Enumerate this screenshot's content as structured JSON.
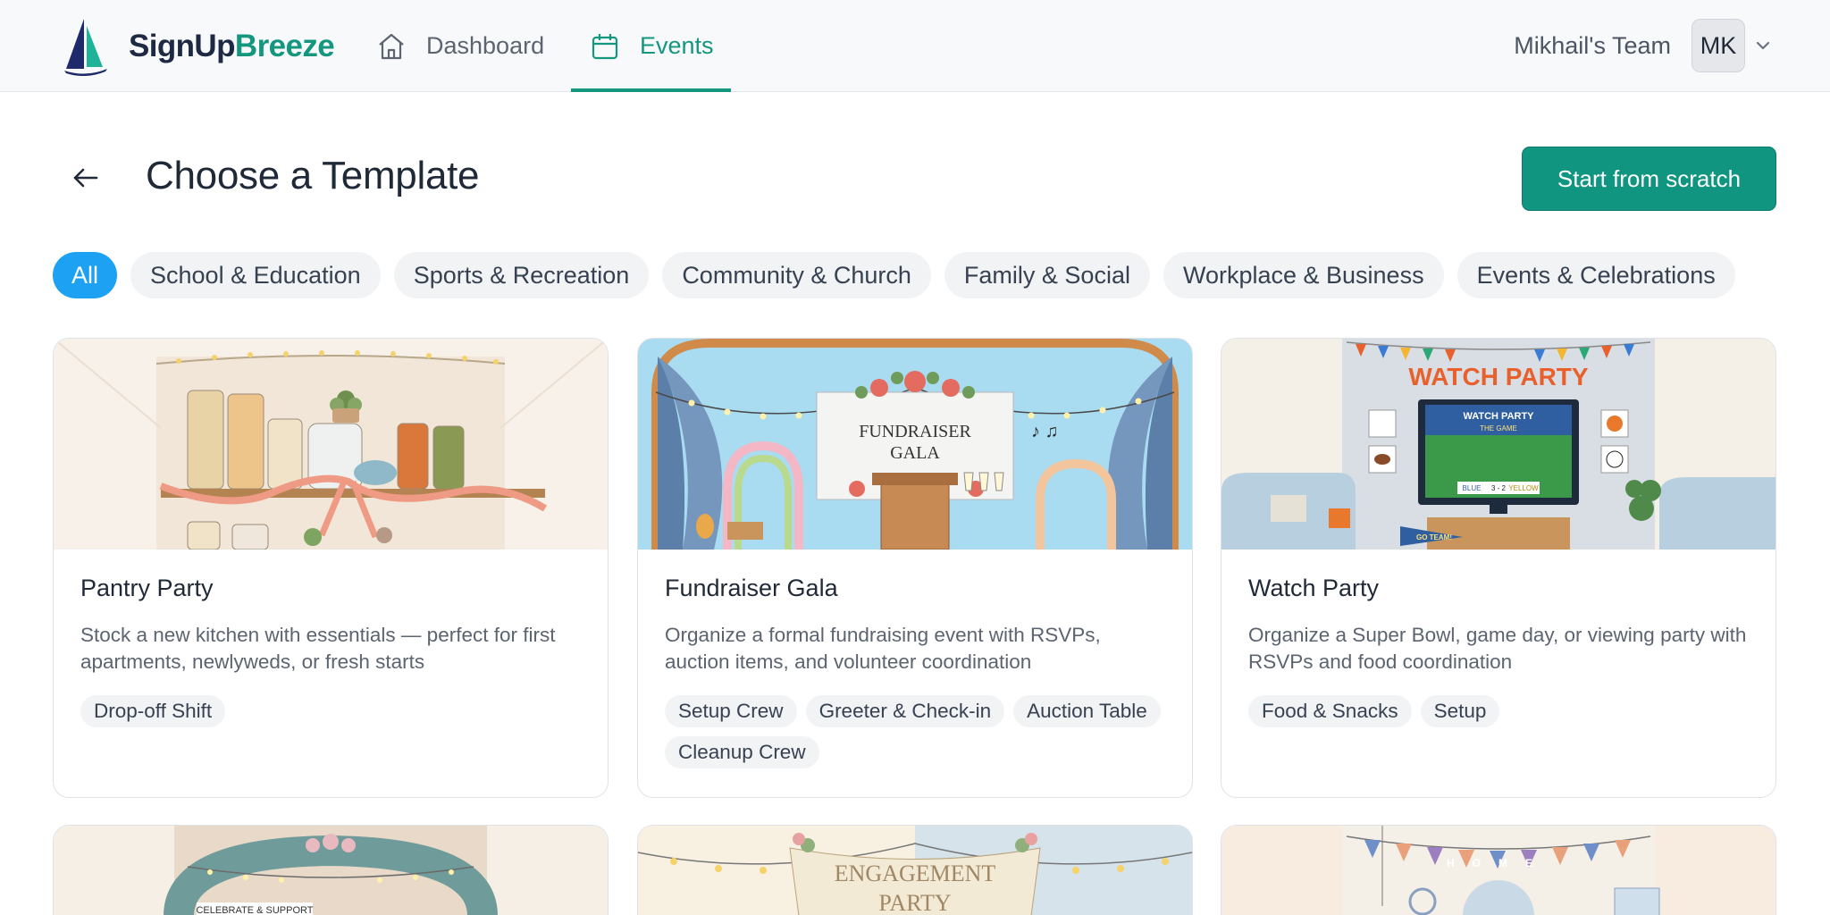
{
  "brand": {
    "name_part1": "SignUp",
    "name_part2": "Breeze",
    "primary_color": "#14967f"
  },
  "nav": [
    {
      "label": "Dashboard",
      "icon": "home-icon",
      "active": false
    },
    {
      "label": "Events",
      "icon": "calendar-icon",
      "active": true
    }
  ],
  "account": {
    "team_name": "Mikhail's Team",
    "initials": "MK"
  },
  "page": {
    "title": "Choose a Template",
    "primary_action": "Start from scratch"
  },
  "filters": [
    "All",
    "School & Education",
    "Sports & Recreation",
    "Community & Church",
    "Family & Social",
    "Workplace & Business",
    "Events & Celebrations"
  ],
  "templates": [
    {
      "title": "Pantry Party",
      "description": "Stock a new kitchen with essentials — perfect for first apartments, newlyweds, or fresh starts",
      "tags": [
        "Drop-off Shift"
      ]
    },
    {
      "title": "Fundraiser Gala",
      "description": "Organize a formal fundraising event with RSVPs, auction items, and volunteer coordination",
      "tags": [
        "Setup Crew",
        "Greeter & Check-in",
        "Auction Table",
        "Cleanup Crew"
      ],
      "image_text": [
        "FUNDRAISER",
        "GALA"
      ]
    },
    {
      "title": "Watch Party",
      "description": "Organize a Super Bowl, game day, or viewing party with RSVPs and food coordination",
      "tags": [
        "Food & Snacks",
        "Setup"
      ],
      "image_text": [
        "WATCH PARTY",
        "WATCH PARTY",
        "THE GAME",
        "BLUE",
        "3 - 2",
        "YELLOW",
        "GO TEAM!"
      ]
    }
  ],
  "more_templates_image_text": {
    "fourth": "CELEBRATE & SUPPORT",
    "fifth": [
      "ENGAGEMENT",
      "PARTY"
    ],
    "sixth": "HOME"
  }
}
